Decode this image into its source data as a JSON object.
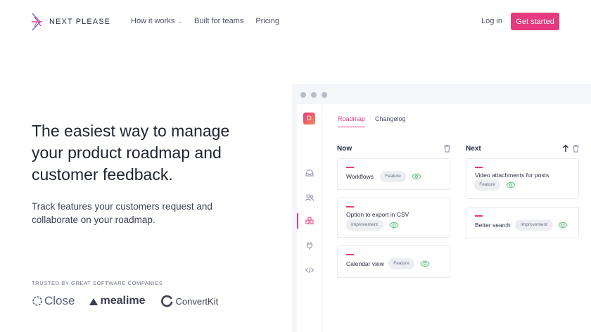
{
  "brand": {
    "name": "NEXT PLEASE"
  },
  "nav": {
    "links": [
      "How it works",
      "Built for teams",
      "Pricing"
    ],
    "login": "Log in",
    "cta": "Get started"
  },
  "hero": {
    "title": "The easiest way to manage your product roadmap and customer feedback.",
    "subtitle": "Track features your customers request and collaborate on your roadmap.",
    "trusted_label": "TRUSTED BY GREAT SOFTWARE COMPANIES",
    "logos": [
      "Close",
      "mealime",
      "ConvertKit"
    ]
  },
  "app": {
    "avatar": "D",
    "tabs": [
      "Roadmap",
      "Changelog"
    ],
    "columns": [
      {
        "title": "Now",
        "cards": [
          {
            "title": "Workflows",
            "tag": "Feature"
          },
          {
            "title": "Option to export in CSV",
            "tag": "Improvement"
          },
          {
            "title": "Calendar view",
            "tag": "Feature"
          }
        ]
      },
      {
        "title": "Next",
        "cards": [
          {
            "title": "Video attachments for posts",
            "tag": "Feature"
          },
          {
            "title": "Better search",
            "tag": "Improvement"
          }
        ]
      }
    ]
  },
  "colors": {
    "accent": "#e6397f",
    "eye": "#6cc58a"
  }
}
